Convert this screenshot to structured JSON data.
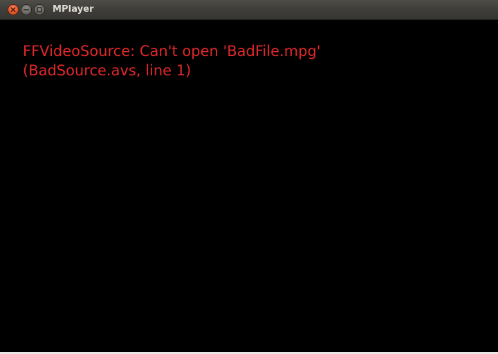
{
  "window": {
    "title": "MPlayer",
    "controls": {
      "close": "close-icon",
      "minimize": "minimize-icon",
      "maximize": "maximize-icon"
    }
  },
  "video": {
    "error_line_1": "FFVideoSource: Can't open 'BadFile.mpg'",
    "error_line_2": "(BadSource.avs, line 1)",
    "error_color": "#e0282a",
    "background": "#000000"
  }
}
